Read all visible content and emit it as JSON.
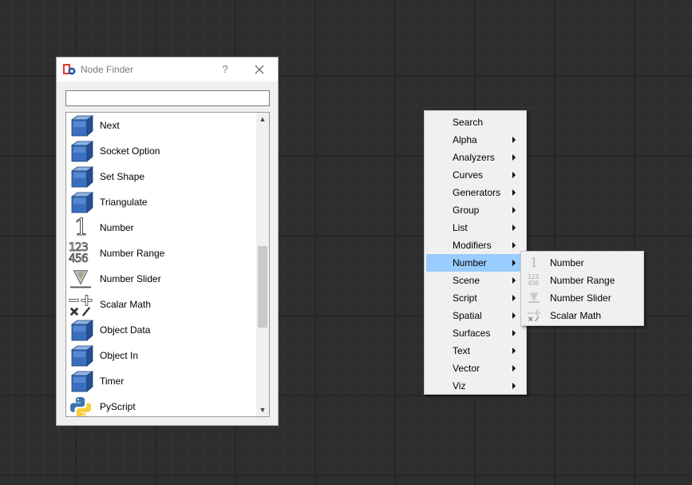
{
  "finder": {
    "title": "Node Finder",
    "help_label": "?",
    "search_value": "",
    "items": [
      {
        "label": "Next",
        "icon": "cube-icon"
      },
      {
        "label": "Socket Option",
        "icon": "cube-icon"
      },
      {
        "label": "Set Shape",
        "icon": "cube-icon"
      },
      {
        "label": "Triangulate",
        "icon": "cube-icon"
      },
      {
        "label": "Number",
        "icon": "number-one-icon",
        "glyph": "1"
      },
      {
        "label": "Number Range",
        "icon": "number-range-icon",
        "glyph_top": "123",
        "glyph_bottom": "456"
      },
      {
        "label": "Number Slider",
        "icon": "slider-icon"
      },
      {
        "label": "Scalar Math",
        "icon": "math-operators-icon"
      },
      {
        "label": "Object Data",
        "icon": "cube-icon"
      },
      {
        "label": "Object In",
        "icon": "cube-icon"
      },
      {
        "label": "Timer",
        "icon": "cube-icon"
      },
      {
        "label": "PyScript",
        "icon": "python-icon"
      }
    ]
  },
  "context_menu": {
    "items": [
      {
        "label": "Search",
        "has_submenu": false
      },
      {
        "label": "Alpha",
        "has_submenu": true
      },
      {
        "label": "Analyzers",
        "has_submenu": true
      },
      {
        "label": "Curves",
        "has_submenu": true
      },
      {
        "label": "Generators",
        "has_submenu": true
      },
      {
        "label": "Group",
        "has_submenu": true
      },
      {
        "label": "List",
        "has_submenu": true
      },
      {
        "label": "Modifiers",
        "has_submenu": true
      },
      {
        "label": "Number",
        "has_submenu": true,
        "active": true
      },
      {
        "label": "Scene",
        "has_submenu": true
      },
      {
        "label": "Script",
        "has_submenu": true
      },
      {
        "label": "Spatial",
        "has_submenu": true
      },
      {
        "label": "Surfaces",
        "has_submenu": true
      },
      {
        "label": "Text",
        "has_submenu": true
      },
      {
        "label": "Vector",
        "has_submenu": true
      },
      {
        "label": "Viz",
        "has_submenu": true
      }
    ],
    "active_color": "#99ccff"
  },
  "number_submenu": {
    "items": [
      {
        "label": "Number",
        "icon": "number-one-icon",
        "glyph": "1"
      },
      {
        "label": "Number Range",
        "icon": "number-range-icon",
        "glyph_top": "123",
        "glyph_bottom": "456"
      },
      {
        "label": "Number Slider",
        "icon": "slider-icon"
      },
      {
        "label": "Scalar Math",
        "icon": "math-operators-icon"
      }
    ]
  }
}
